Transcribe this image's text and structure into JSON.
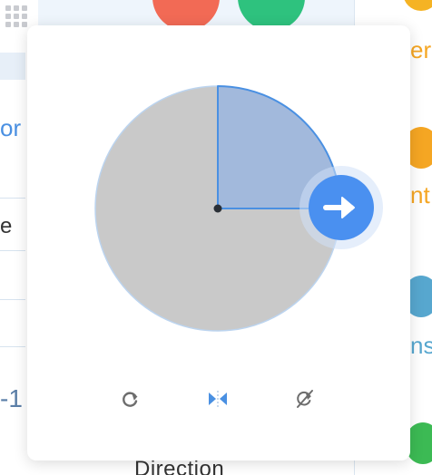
{
  "background": {
    "left_labels": [
      "or",
      "e",
      "-1"
    ],
    "right_labels": [
      "er",
      "nt",
      "ns"
    ],
    "bottom_label": "Direction"
  },
  "direction_control": {
    "angle_deg": 90,
    "direction_icon": "arrow-right-icon",
    "colors": {
      "disc": "#c9c9c9",
      "sector": "#a2b9dc",
      "accent": "#4a90e2",
      "handle": "#4a90f0"
    }
  },
  "toolbar": {
    "items": [
      {
        "icon": "rotate-icon"
      },
      {
        "icon": "flip-horizontal-icon"
      },
      {
        "icon": "no-direction-icon"
      }
    ]
  }
}
